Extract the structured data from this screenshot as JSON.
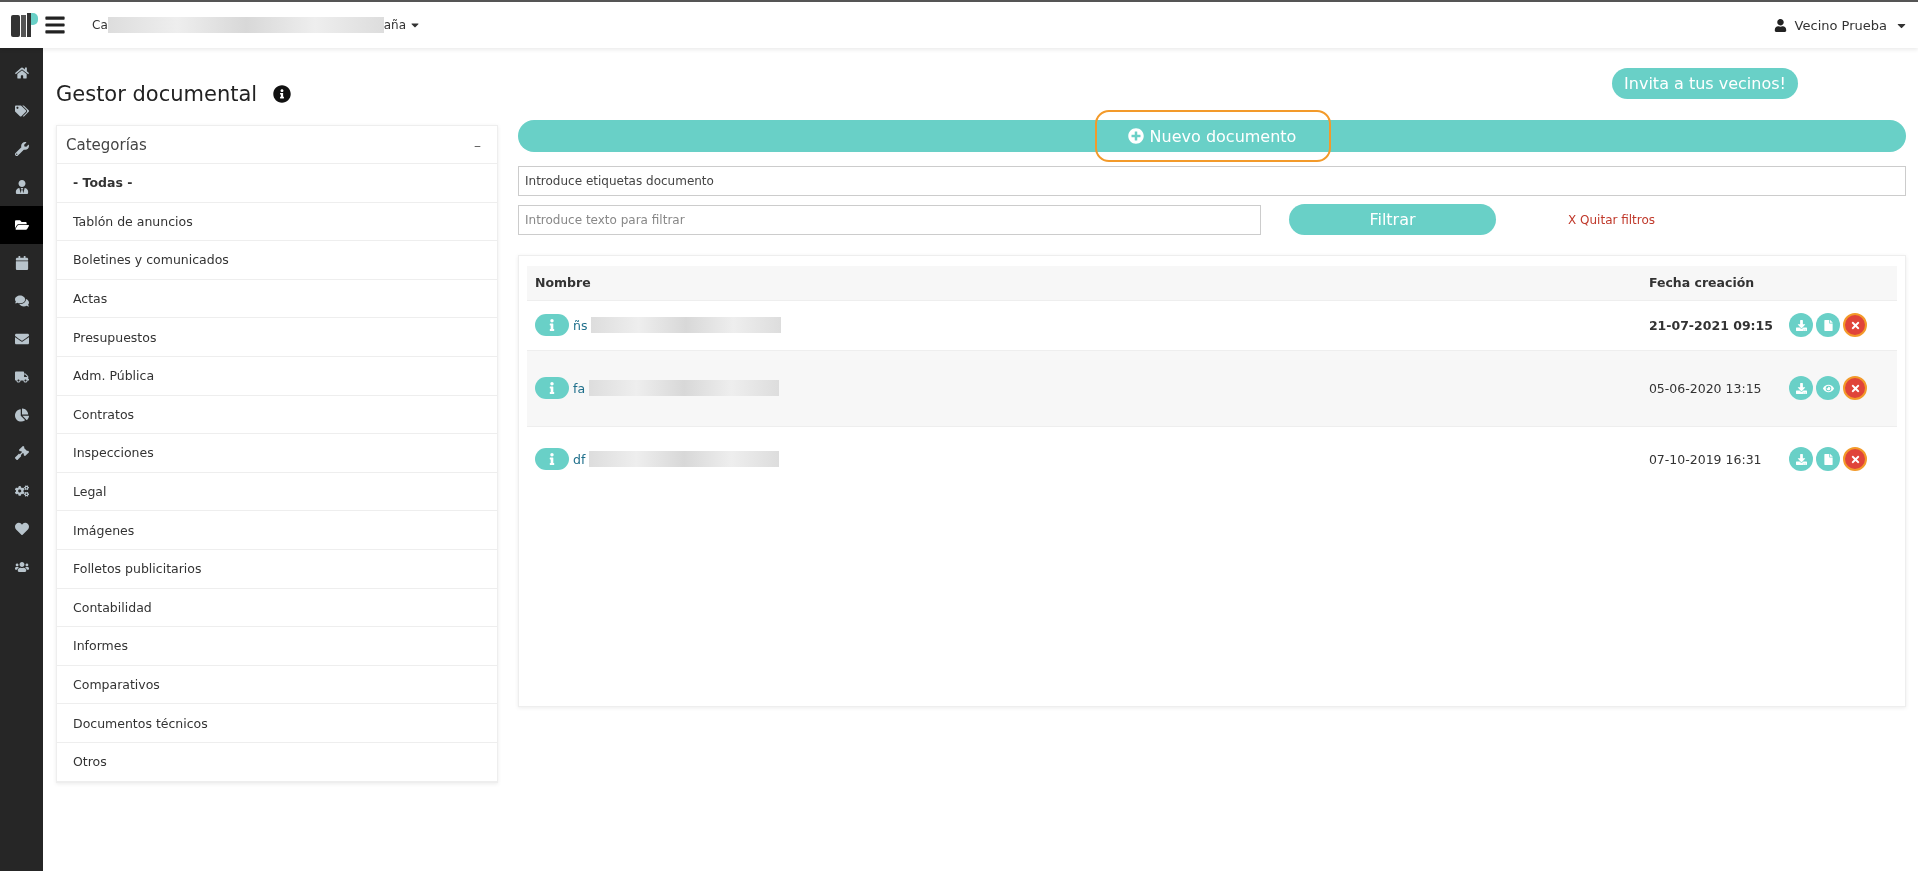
{
  "topbar": {
    "community_start": "Ca",
    "community_end": "aña",
    "user": "Vecino Prueba"
  },
  "sidebar": {
    "items": [
      {
        "kind": "home",
        "selected": false
      },
      {
        "kind": "tags",
        "selected": false
      },
      {
        "kind": "wrench",
        "selected": false
      },
      {
        "kind": "person",
        "selected": false
      },
      {
        "kind": "folder",
        "selected": true
      },
      {
        "kind": "calendar",
        "selected": false
      },
      {
        "kind": "chat",
        "selected": false
      },
      {
        "kind": "mail",
        "selected": false
      },
      {
        "kind": "truck",
        "selected": false
      },
      {
        "kind": "pie",
        "selected": false
      },
      {
        "kind": "gavel",
        "selected": false
      },
      {
        "kind": "cogs",
        "selected": false
      },
      {
        "kind": "heart",
        "selected": false
      },
      {
        "kind": "users",
        "selected": false
      }
    ]
  },
  "page_title": "Gestor documental",
  "invite_button": "Invita a tus vecinos!",
  "categories": {
    "title": "Categorías",
    "toggle": "–",
    "items": [
      {
        "label": "- Todas -",
        "selected": true
      },
      {
        "label": "Tablón de anuncios",
        "selected": false
      },
      {
        "label": "Boletines y comunicados",
        "selected": false
      },
      {
        "label": "Actas",
        "selected": false
      },
      {
        "label": "Presupuestos",
        "selected": false
      },
      {
        "label": "Adm. Pública",
        "selected": false
      },
      {
        "label": "Contratos",
        "selected": false
      },
      {
        "label": "Inspecciones",
        "selected": false
      },
      {
        "label": "Legal",
        "selected": false
      },
      {
        "label": "Imágenes",
        "selected": false
      },
      {
        "label": "Folletos publicitarios",
        "selected": false
      },
      {
        "label": "Contabilidad",
        "selected": false
      },
      {
        "label": "Informes",
        "selected": false
      },
      {
        "label": "Comparativos",
        "selected": false
      },
      {
        "label": "Documentos técnicos",
        "selected": false
      },
      {
        "label": "Otros",
        "selected": false
      }
    ]
  },
  "new_document": {
    "label": "Nuevo documento",
    "highlighted": true
  },
  "tags_field": {
    "value": "Introduce etiquetas documento"
  },
  "text_filter": {
    "placeholder": "Introduce texto para filtrar"
  },
  "filter_button": "Filtrar",
  "clear_filters": "X Quitar filtros",
  "table": {
    "columns": [
      "Nombre",
      "Fecha creación"
    ],
    "rows": [
      {
        "name": "ñs",
        "date": "21-07-2021 09:15",
        "bold": true,
        "actions": [
          {
            "kind": "download",
            "highlighted": false
          },
          {
            "kind": "file",
            "highlighted": false
          },
          {
            "kind": "delete",
            "highlighted": true
          }
        ]
      },
      {
        "name": "fa",
        "date": "05-06-2020 13:15",
        "bold": false,
        "actions": [
          {
            "kind": "download",
            "highlighted": false
          },
          {
            "kind": "view",
            "highlighted": false
          },
          {
            "kind": "delete",
            "highlighted": true
          }
        ]
      },
      {
        "name": "df",
        "date": "07-10-2019 16:31",
        "bold": false,
        "actions": [
          {
            "kind": "download",
            "highlighted": false
          },
          {
            "kind": "file",
            "highlighted": false
          },
          {
            "kind": "delete",
            "highlighted": true
          }
        ]
      }
    ]
  }
}
